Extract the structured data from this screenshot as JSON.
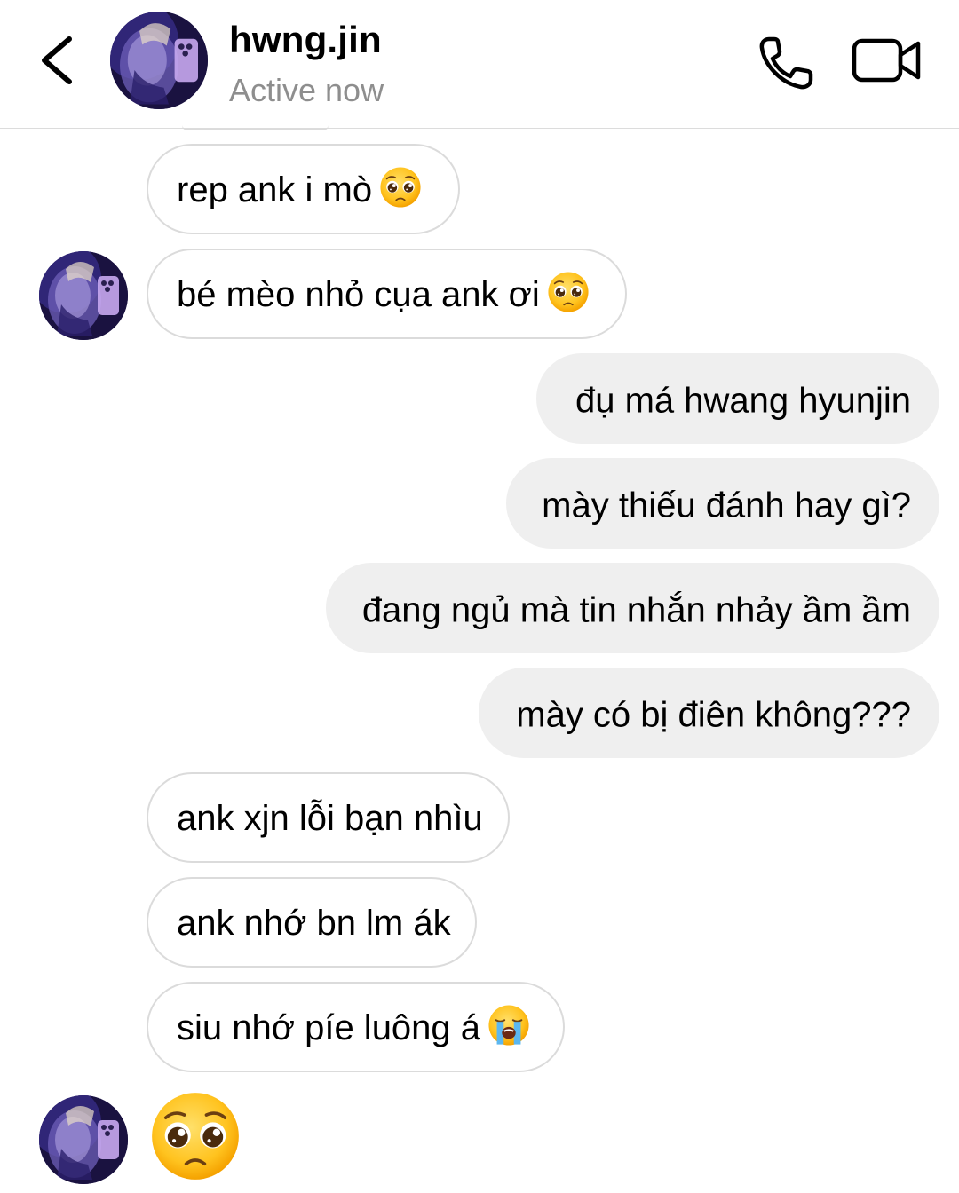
{
  "header": {
    "username": "hwng.jin",
    "status": "Active now",
    "back_icon": "chevron-left-icon",
    "call_icon": "phone-icon",
    "video_icon": "video-camera-icon"
  },
  "messages": [
    {
      "side": "in",
      "text": "rep ank i mò",
      "emoji": "pleading-face"
    },
    {
      "side": "in",
      "text": "bé mèo nhỏ cụa ank ơi",
      "emoji": "pleading-face"
    },
    {
      "side": "out",
      "text": "đụ má hwang hyunjin"
    },
    {
      "side": "out",
      "text": "mày thiếu đánh hay gì?"
    },
    {
      "side": "out",
      "text": "đang ngủ mà tin nhắn nhảy ầm ầm"
    },
    {
      "side": "out",
      "text": "mày có bị điên không???"
    },
    {
      "side": "in",
      "text": "ank xjn lỗi bạn nhìu"
    },
    {
      "side": "in",
      "text": "ank nhớ bn lm ák"
    },
    {
      "side": "in",
      "text": "siu nhớ píe luông á",
      "emoji": "loudly-crying-face"
    },
    {
      "side": "in",
      "text": "",
      "emoji": "pleading-face-large"
    }
  ],
  "colors": {
    "incoming_bubble_border": "#dbdbdb",
    "outgoing_bubble_bg": "#efefef",
    "status_text": "#8e8e8e"
  }
}
